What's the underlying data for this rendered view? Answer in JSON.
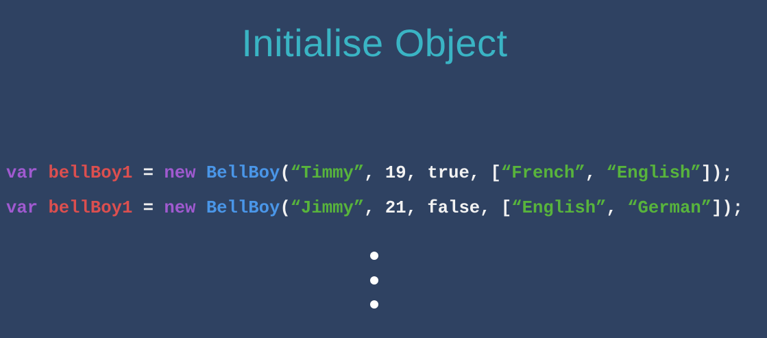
{
  "title": "Initialise Object",
  "colors": {
    "keyword": "#a05ad0",
    "variable": "#dc4f4f",
    "class": "#4a96e8",
    "string": "#58b43c",
    "plain": "#f2f2f2"
  },
  "code_lines": [
    [
      {
        "t": "var",
        "c": "keyword"
      },
      {
        "t": " ",
        "c": "plain"
      },
      {
        "t": "bellBoy1",
        "c": "variable"
      },
      {
        "t": " = ",
        "c": "plain"
      },
      {
        "t": "new",
        "c": "keyword"
      },
      {
        "t": " ",
        "c": "plain"
      },
      {
        "t": "BellBoy",
        "c": "class"
      },
      {
        "t": "(",
        "c": "plain"
      },
      {
        "t": "“Timmy”",
        "c": "string"
      },
      {
        "t": ", 19, true, [",
        "c": "plain"
      },
      {
        "t": "“French”",
        "c": "string"
      },
      {
        "t": ", ",
        "c": "plain"
      },
      {
        "t": "“English”",
        "c": "string"
      },
      {
        "t": "]);",
        "c": "plain"
      }
    ],
    [
      {
        "t": "var",
        "c": "keyword"
      },
      {
        "t": " ",
        "c": "plain"
      },
      {
        "t": "bellBoy1",
        "c": "variable"
      },
      {
        "t": " = ",
        "c": "plain"
      },
      {
        "t": "new",
        "c": "keyword"
      },
      {
        "t": " ",
        "c": "plain"
      },
      {
        "t": "BellBoy",
        "c": "class"
      },
      {
        "t": "(",
        "c": "plain"
      },
      {
        "t": "“Jimmy”",
        "c": "string"
      },
      {
        "t": ", 21, false, [",
        "c": "plain"
      },
      {
        "t": "“English”",
        "c": "string"
      },
      {
        "t": ", ",
        "c": "plain"
      },
      {
        "t": "“German”",
        "c": "string"
      },
      {
        "t": "]);",
        "c": "plain"
      }
    ]
  ]
}
